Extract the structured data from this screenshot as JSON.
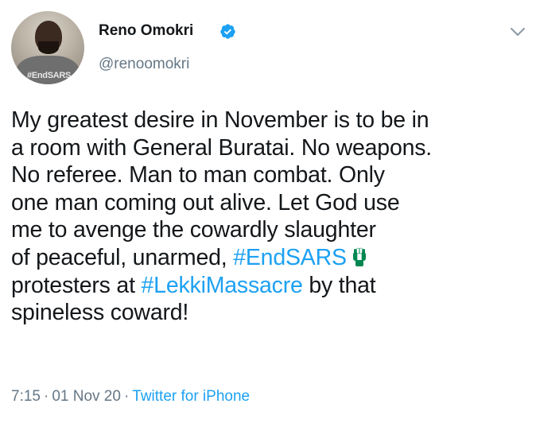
{
  "author": {
    "name": "Reno Omokri",
    "handle": "@renoomokri",
    "avatar_shirt_text": "#EndSARS",
    "verified": true
  },
  "tweet": {
    "lines": [
      [
        {
          "text": "My greatest desire in November is to be in"
        }
      ],
      [
        {
          "text": "a room with General Buratai. No weapons."
        }
      ],
      [
        {
          "text": "No referee. Man to man combat. Only"
        }
      ],
      [
        {
          "text": "one man coming out alive. Let God use"
        }
      ],
      [
        {
          "text": "me to avenge the cowardly slaughter"
        }
      ],
      [
        {
          "text": "of peaceful, unarmed, "
        },
        {
          "hashtag": "#EndSARS"
        }
      ],
      [
        {
          "text": "protesters at "
        },
        {
          "hashtag": "#LekkiMassacre"
        },
        {
          "text": " by that"
        }
      ],
      [
        {
          "text": "spineless coward!"
        }
      ]
    ],
    "emoji_icon": "raised-fist-green-white-icon"
  },
  "meta": {
    "time": "7:15",
    "separator": "·",
    "date": "01 Nov 20",
    "source": "Twitter for iPhone"
  },
  "colors": {
    "text": "#14171a",
    "secondary": "#657786",
    "link": "#1da1f2",
    "verified_badge": "#1da1f2",
    "flag_green": "#008751"
  }
}
